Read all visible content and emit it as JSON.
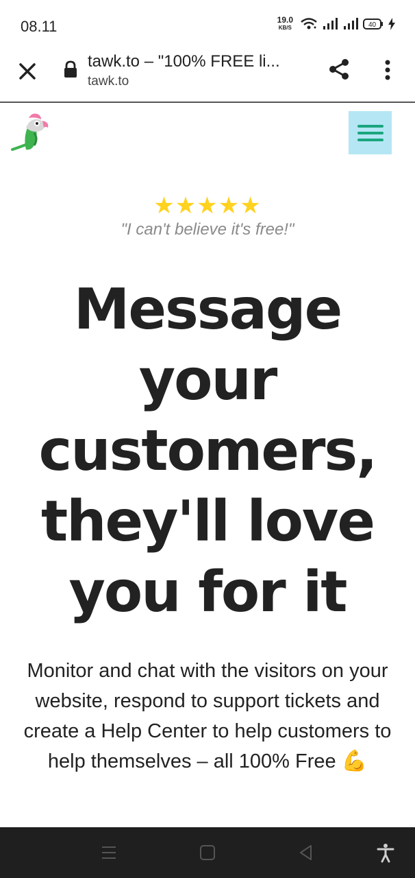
{
  "status_bar": {
    "time": "08.11",
    "net_speed_value": "19.0",
    "net_speed_unit": "KB/S",
    "battery": "40"
  },
  "browser": {
    "page_title": "tawk.to – \"100% FREE li...",
    "domain": "tawk.to"
  },
  "hero": {
    "stars": "★★★★★",
    "rating_stars": 5,
    "quote": "\"I can't believe it's free!\"",
    "headline_lines": [
      "Message",
      "your",
      "customers,",
      "they'll love",
      "you for it"
    ],
    "description": "Monitor and chat with the visitors on your website, respond to support tickets and create a Help Center to help customers to help themselves – all 100% Free",
    "emoji": "💪"
  },
  "colors": {
    "star": "#ffd21f",
    "menu_bg": "#b4e6f4",
    "menu_lines": "#1aa57e",
    "nav_bg": "#1f1f1f"
  }
}
